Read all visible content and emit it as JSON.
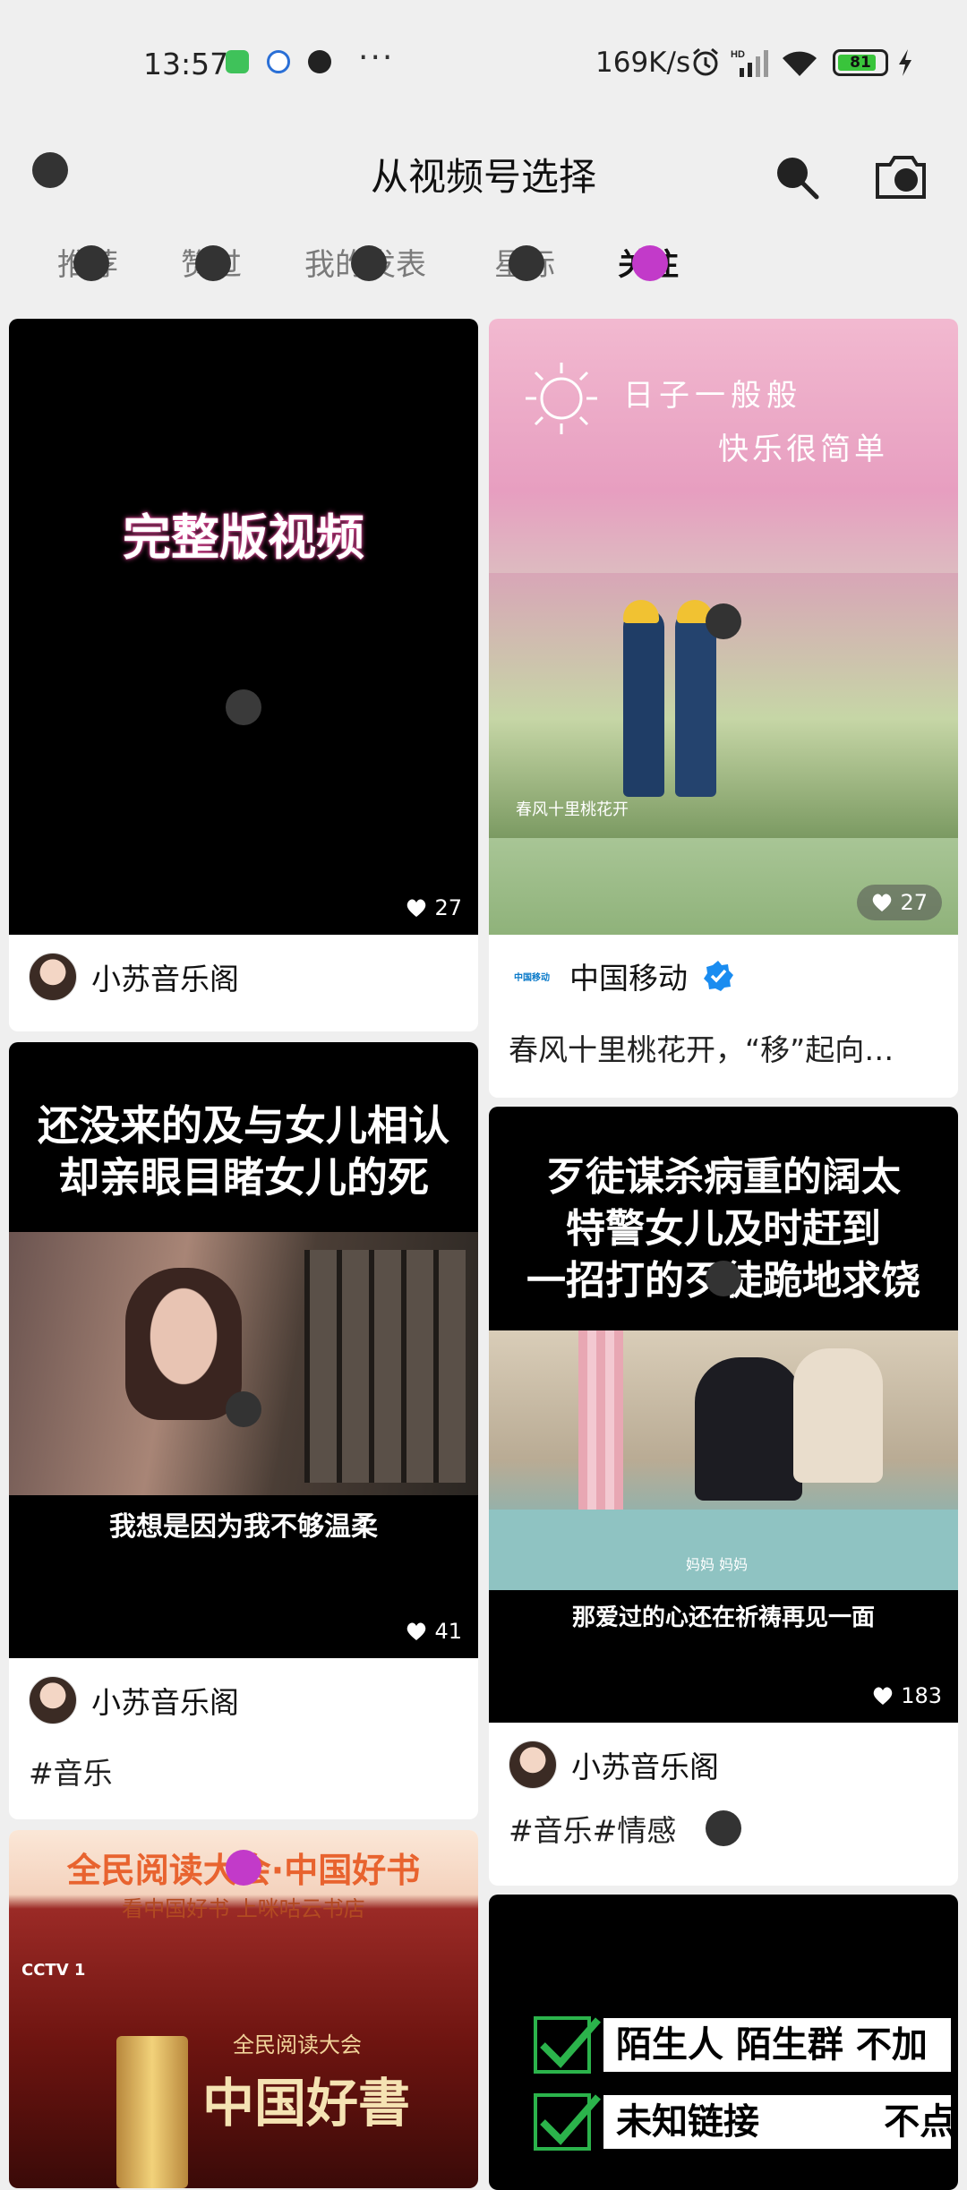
{
  "status_bar": {
    "time": "13:57",
    "dots": "···",
    "net_speed": "169K/s",
    "battery": "81",
    "icons": [
      "app-green-icon",
      "app-blue-icon",
      "app-panda-icon",
      "alarm-icon",
      "signal-icon",
      "wifi-icon",
      "battery-icon",
      "charging-icon"
    ]
  },
  "header": {
    "title": "从视频号选择",
    "icons": [
      "back-icon",
      "search-icon",
      "camera-icon"
    ]
  },
  "tabs": [
    {
      "label": "推荐",
      "active": false
    },
    {
      "label": "赞过",
      "active": false
    },
    {
      "label": "我的发表",
      "active": false
    },
    {
      "label": "星标",
      "active": false
    },
    {
      "label": "关注",
      "active": true
    }
  ],
  "feed": {
    "col1": [
      {
        "overlay": "完整版视频",
        "likes": "27",
        "author": "小苏音乐阁",
        "desc": ""
      },
      {
        "overlay_top": [
          "还没来的及与女儿相认",
          "却亲眼目睹女儿的死"
        ],
        "subtitle": "我想是因为我不够温柔",
        "likes": "41",
        "author": "小苏音乐阁",
        "desc": "#音乐"
      },
      {
        "banner_title": "全民阅读大会·中国好书",
        "banner_sub": "看中国好书 上咪咕云书店",
        "tv_logo": "CCTV 1",
        "poster_small": "全民阅读大会",
        "poster_big": "中国好書"
      }
    ],
    "col2": [
      {
        "overlay_lines": [
          "日子一般般",
          "快乐很简单"
        ],
        "caption_small": "春风十里桃花开",
        "likes": "27",
        "author": "中国移动",
        "logo_text": "中国移动",
        "verified": true,
        "desc": "春风十里桃花开，“移”起向…"
      },
      {
        "overlay_top": [
          "歹徒谋杀病重的阔太",
          "特警女儿及时赶到",
          "一招打的歹徒跪地求饶"
        ],
        "caption_small": "妈妈 妈妈",
        "subtitle": "那爱过的心还在祈祷再见一面",
        "likes": "183",
        "author": "小苏音乐阁",
        "desc": "#音乐#情感"
      },
      {
        "checklist": [
          "陌生人 陌生群 不加",
          "未知链接          不点"
        ]
      }
    ]
  },
  "colors": {
    "accent_pink": "#c23ac9",
    "verified_blue": "#1a8cf0",
    "check_green": "#2bb34b"
  }
}
